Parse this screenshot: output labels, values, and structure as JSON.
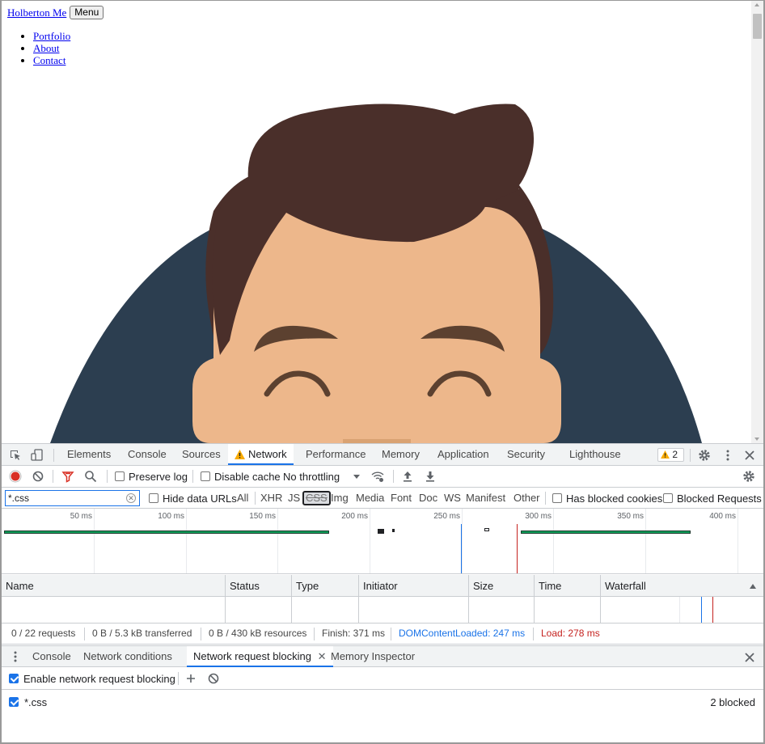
{
  "site": {
    "title": "Holberton Me",
    "menu_button": "Menu",
    "nav": [
      "Portfolio",
      "About",
      "Contact"
    ]
  },
  "devtools": {
    "tabs": [
      "Elements",
      "Console",
      "Sources",
      "Network",
      "Performance",
      "Memory",
      "Application",
      "Security",
      "Lighthouse"
    ],
    "active_tab": "Network",
    "warning_count": "2",
    "toolbar": {
      "preserve_log": "Preserve log",
      "disable_cache": "Disable cache",
      "throttling": "No throttling"
    },
    "filter": {
      "value": "*.css",
      "hide_data_urls": "Hide data URLs",
      "types": [
        "All",
        "XHR",
        "JS",
        "CSS",
        "Img",
        "Media",
        "Font",
        "Doc",
        "WS",
        "Manifest",
        "Other"
      ],
      "active_type": "CSS",
      "has_blocked_cookies": "Has blocked cookies",
      "blocked_requests": "Blocked Requests"
    },
    "overview_ticks": [
      "50 ms",
      "100 ms",
      "150 ms",
      "200 ms",
      "250 ms",
      "300 ms",
      "350 ms",
      "400 ms"
    ],
    "columns": [
      "Name",
      "Status",
      "Type",
      "Initiator",
      "Size",
      "Time",
      "Waterfall"
    ],
    "summary": {
      "requests": "0 / 22 requests",
      "transferred": "0 B / 5.3 kB transferred",
      "resources": "0 B / 430 kB resources",
      "finish": "Finish: 371 ms",
      "dom_content_loaded": "DOMContentLoaded: 247 ms",
      "load": "Load: 278 ms"
    },
    "drawer": {
      "tabs": [
        "Console",
        "Network conditions",
        "Network request blocking",
        "Memory Inspector"
      ],
      "active_tab": "Network request blocking",
      "enable_label": "Enable network request blocking",
      "patterns": [
        {
          "pattern": "*.css",
          "count": "2 blocked",
          "enabled": true
        }
      ]
    }
  },
  "colors": {
    "accent": "#1a73e8",
    "dom_content_loaded": "#1a73e8",
    "load": "#c5221f",
    "hair": "#4a2f2a",
    "skin": "#edb78b",
    "brows": "#5c4130",
    "background_circle": "#2c3e50"
  }
}
